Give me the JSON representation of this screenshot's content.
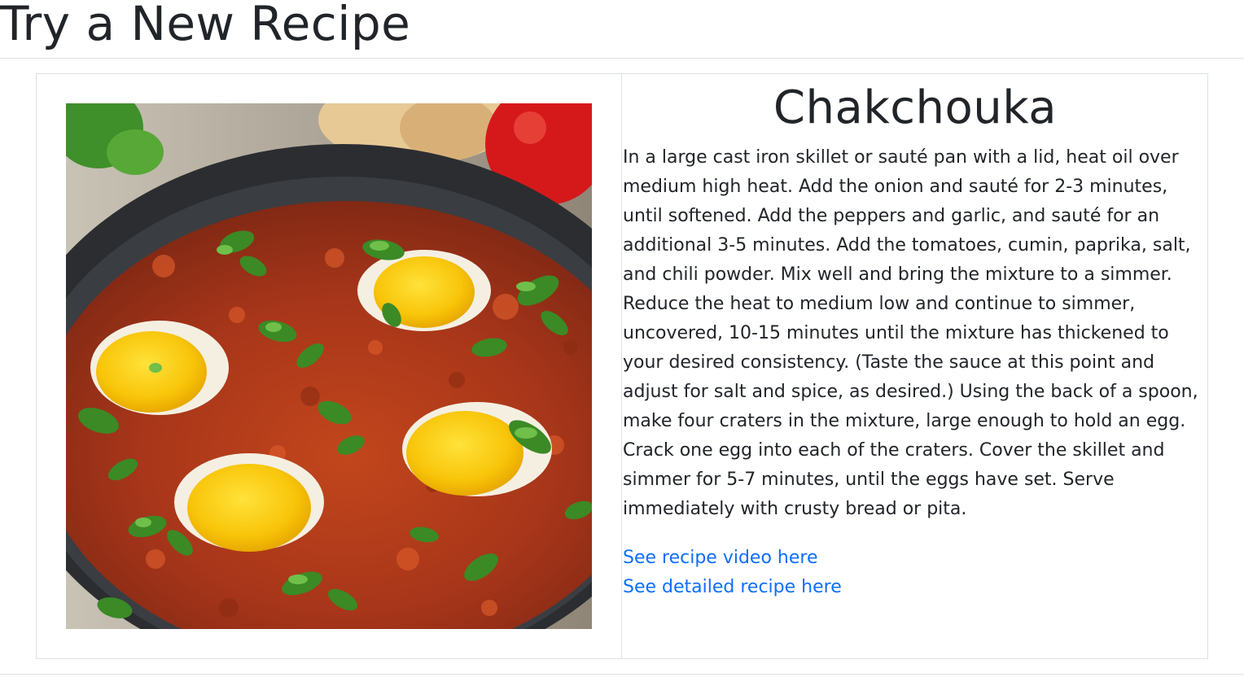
{
  "page": {
    "title": "Try a New Recipe"
  },
  "recipe": {
    "name": "Chakchouka",
    "instructions": "In a large cast iron skillet or sauté pan with a lid, heat oil over medium high heat. Add the onion and sauté for 2-3 minutes, until softened. Add the peppers and garlic, and sauté for an additional 3-5 minutes. Add the tomatoes, cumin, paprika, salt, and chili powder. Mix well and bring the mixture to a simmer. Reduce the heat to medium low and continue to simmer, uncovered, 10-15 minutes until the mixture has thickened to your desired consistency. (Taste the sauce at this point and adjust for salt and spice, as desired.) Using the back of a spoon, make four craters in the mixture, large enough to hold an egg. Crack one egg into each of the craters. Cover the skillet and simmer for 5-7 minutes, until the eggs have set. Serve immediately with crusty bread or pita.",
    "video_link_label": "See recipe video here",
    "detail_link_label": "See detailed recipe here"
  },
  "colors": {
    "text": "#212529",
    "link": "#0d6efd",
    "border": "#dee2e6"
  }
}
